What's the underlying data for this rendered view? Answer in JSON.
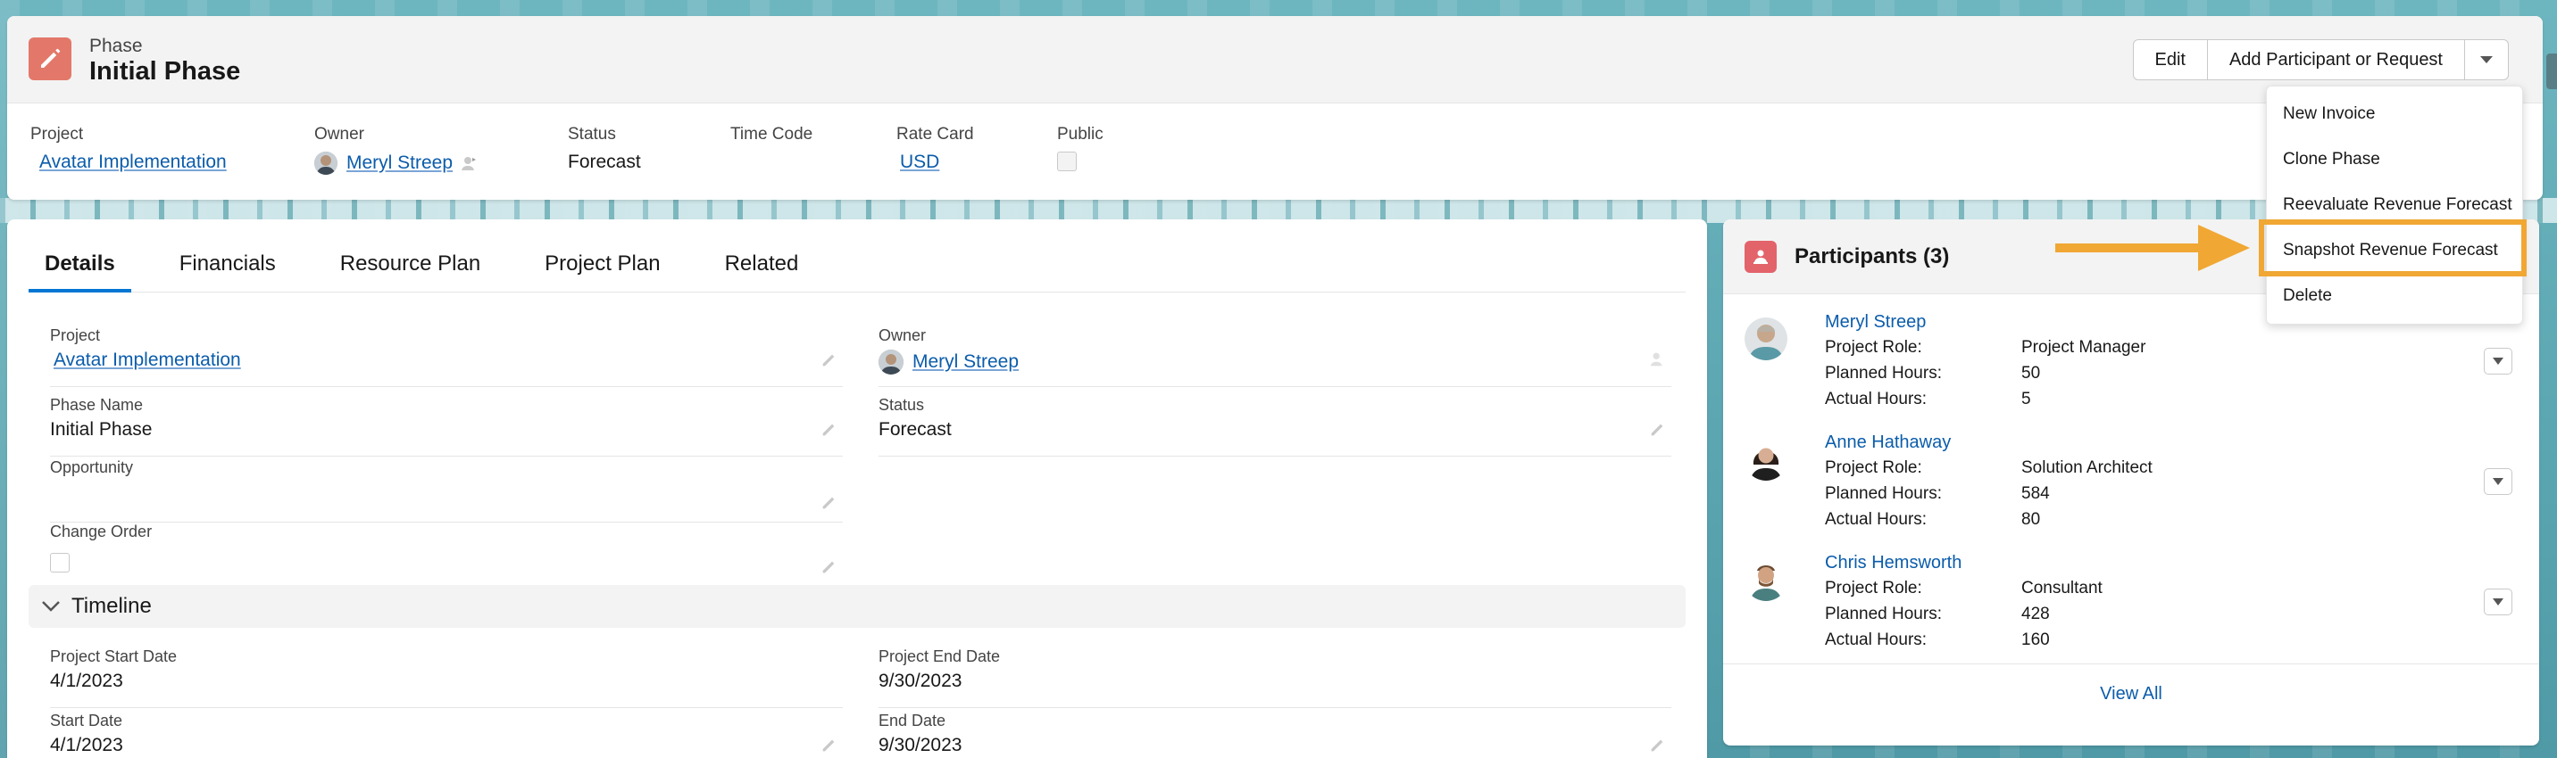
{
  "header": {
    "record_type": "Phase",
    "title": "Initial Phase",
    "icon": "pencil-icon",
    "buttons": {
      "edit": "Edit",
      "add_participant": "Add Participant or Request"
    },
    "highlights": [
      {
        "label": "Project",
        "value": "Avatar Implementation"
      },
      {
        "label": "Owner",
        "value": "Meryl Streep"
      },
      {
        "label": "Status",
        "value": "Forecast"
      },
      {
        "label": "Time Code",
        "value": ""
      },
      {
        "label": "Rate Card",
        "value": "USD"
      },
      {
        "label": "Public",
        "value": ""
      }
    ]
  },
  "menu": {
    "items": [
      "New Invoice",
      "Clone Phase",
      "Reevaluate Revenue Forecast",
      "Snapshot Revenue Forecast",
      "Delete"
    ],
    "highlighted": "Snapshot Revenue Forecast",
    "highlight_color": "#f0a734"
  },
  "tabs": [
    "Details",
    "Financials",
    "Resource Plan",
    "Project Plan",
    "Related"
  ],
  "details": {
    "project_label": "Project",
    "project_value": "Avatar Implementation",
    "owner_label": "Owner",
    "owner_value": "Meryl Streep",
    "phase_name_label": "Phase Name",
    "phase_name_value": "Initial Phase",
    "status_label": "Status",
    "status_value": "Forecast",
    "opportunity_label": "Opportunity",
    "opportunity_value": "",
    "change_order_label": "Change Order",
    "timeline_title": "Timeline",
    "project_start_label": "Project Start Date",
    "project_start_value": "4/1/2023",
    "project_end_label": "Project End Date",
    "project_end_value": "9/30/2023",
    "start_label": "Start Date",
    "start_value": "4/1/2023",
    "end_label": "End Date",
    "end_value": "9/30/2023"
  },
  "participants": {
    "title": "Participants (3)",
    "role_label": "Project Role:",
    "planned_label": "Planned Hours:",
    "actual_label": "Actual Hours:",
    "people": [
      {
        "name": "Meryl Streep",
        "role": "Project Manager",
        "planned": "50",
        "actual": "5"
      },
      {
        "name": "Anne Hathaway",
        "role": "Solution Architect",
        "planned": "584",
        "actual": "80"
      },
      {
        "name": "Chris Hemsworth",
        "role": "Consultant",
        "planned": "428",
        "actual": "160"
      }
    ],
    "view_all": "View All"
  },
  "colors": {
    "brand_link": "#0b5cab",
    "active_tab": "#0176d3",
    "phase_icon": "#e3786a",
    "participants_icon": "#e3636a"
  }
}
